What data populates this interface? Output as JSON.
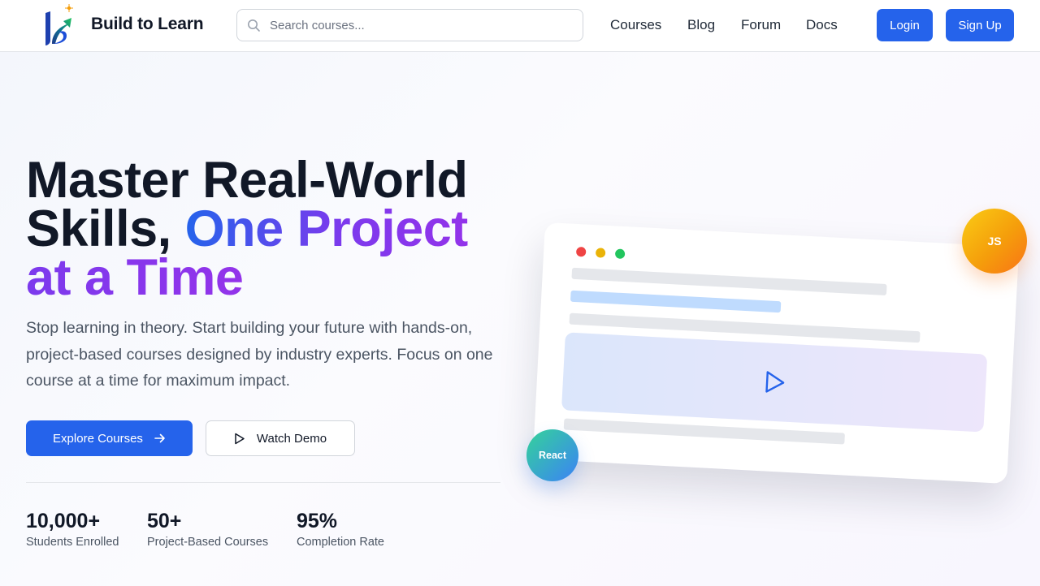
{
  "header": {
    "brand": "Build to Learn",
    "search_placeholder": "Search courses...",
    "nav": [
      "Courses",
      "Blog",
      "Forum",
      "Docs"
    ],
    "login_label": "Login",
    "signup_label": "Sign Up"
  },
  "hero": {
    "title_line1": "Master Real-World",
    "title_line2_plain": "Skills, ",
    "title_line2_accent": "One Project",
    "title_line3_accent": "at a Time",
    "subtitle": "Stop learning in theory. Start building your future with hands-on, project-based courses designed by industry experts. Focus on one course at a time for maximum impact.",
    "primary_cta": "Explore Courses",
    "secondary_cta": "Watch Demo"
  },
  "stats": [
    {
      "value": "10,000+",
      "label": "Students Enrolled"
    },
    {
      "value": "50+",
      "label": "Project-Based Courses"
    },
    {
      "value": "95%",
      "label": "Completion Rate"
    }
  ],
  "illustration": {
    "badge_js": "JS",
    "badge_react": "React",
    "window_dots": [
      "#ef4444",
      "#eab308",
      "#22c55e"
    ]
  },
  "colors": {
    "accent": "#2563eb",
    "accent_purple": "#7c3aed",
    "text_dark": "#111827",
    "text_muted": "#4b5563"
  },
  "icons": {
    "search": "search-icon",
    "arrow": "arrow-right-icon",
    "play": "play-icon",
    "logo": "logo-icon"
  }
}
